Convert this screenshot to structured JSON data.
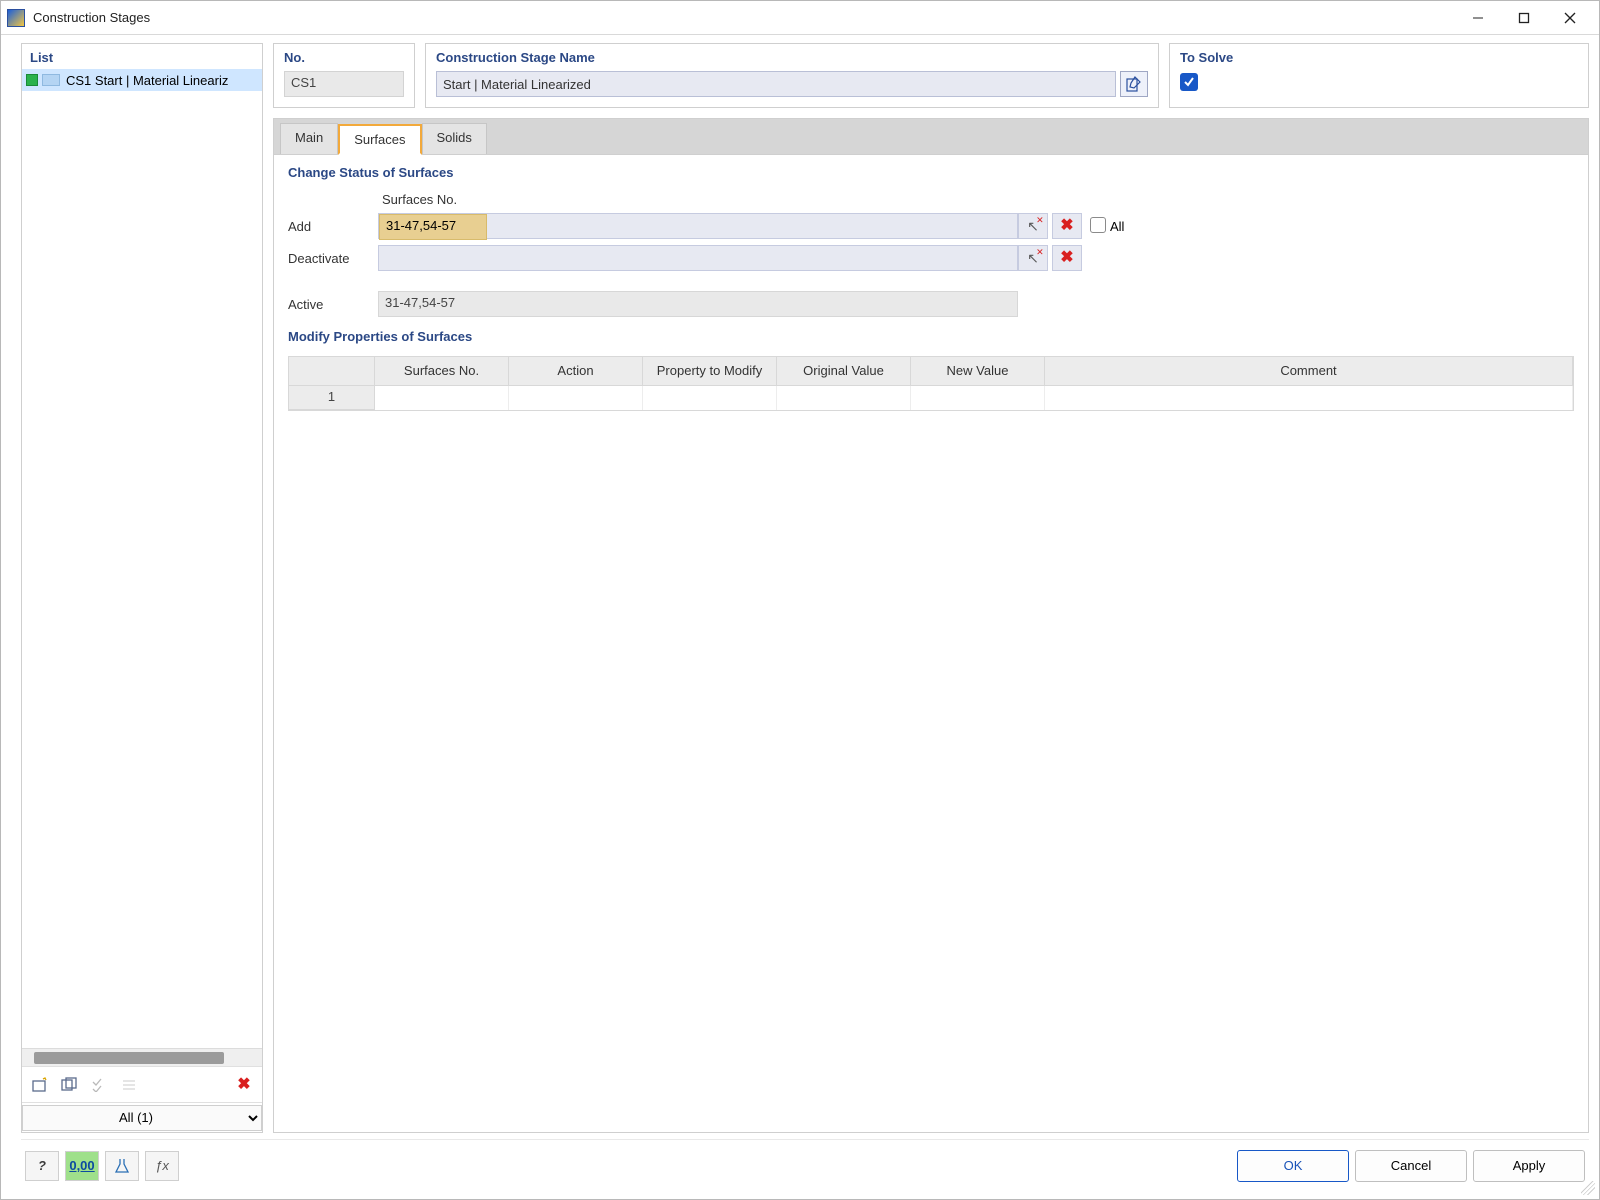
{
  "window": {
    "title": "Construction Stages"
  },
  "left": {
    "header": "List",
    "items": [
      {
        "id": "CS1",
        "label": "CS1  Start | Material Lineariz"
      }
    ],
    "filter_selected": "All (1)"
  },
  "header": {
    "no_label": "No.",
    "no_value": "CS1",
    "name_label": "Construction Stage Name",
    "name_value": "Start | Material Linearized",
    "solve_label": "To Solve",
    "solve_checked": true
  },
  "tabs": {
    "main": "Main",
    "surfaces": "Surfaces",
    "solids": "Solids",
    "active": "surfaces"
  },
  "status": {
    "section": "Change Status of Surfaces",
    "col_header": "Surfaces No.",
    "rows": {
      "add": {
        "label": "Add",
        "value": "31-47,54-57"
      },
      "deactivate": {
        "label": "Deactivate",
        "value": ""
      },
      "active": {
        "label": "Active",
        "value": "31-47,54-57"
      }
    },
    "all_label": "All"
  },
  "props": {
    "section": "Modify Properties of Surfaces",
    "columns": {
      "rownum": "",
      "surfno": "Surfaces No.",
      "action": "Action",
      "prop": "Property to Modify",
      "orig": "Original Value",
      "newv": "New Value",
      "comment": "Comment"
    },
    "rows": [
      {
        "n": "1",
        "surfno": "",
        "action": "",
        "prop": "",
        "orig": "",
        "newv": "",
        "comment": ""
      }
    ]
  },
  "footer": {
    "ok": "OK",
    "cancel": "Cancel",
    "apply": "Apply"
  }
}
